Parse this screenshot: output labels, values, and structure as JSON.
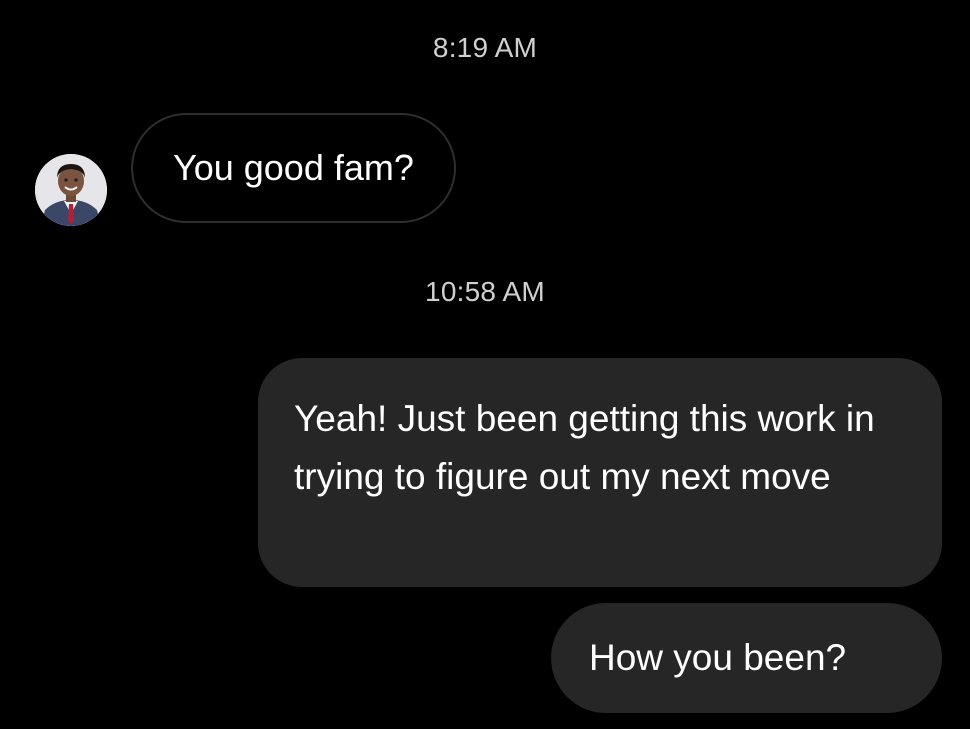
{
  "conversation": {
    "timestamps": [
      "8:19 AM",
      "10:58 AM"
    ],
    "incoming": [
      {
        "text": "You good fam?"
      }
    ],
    "outgoing": [
      {
        "text": "Yeah! Just been getting this work in trying to figure out my next move"
      },
      {
        "text": "How you been?"
      }
    ]
  },
  "colors": {
    "background": "#000000",
    "outgoing_bubble": "#262626",
    "incoming_border": "#2e2e2e",
    "timestamp_text": "#d0d0d0"
  },
  "icons": {
    "avatar": "contact-avatar-photo"
  }
}
